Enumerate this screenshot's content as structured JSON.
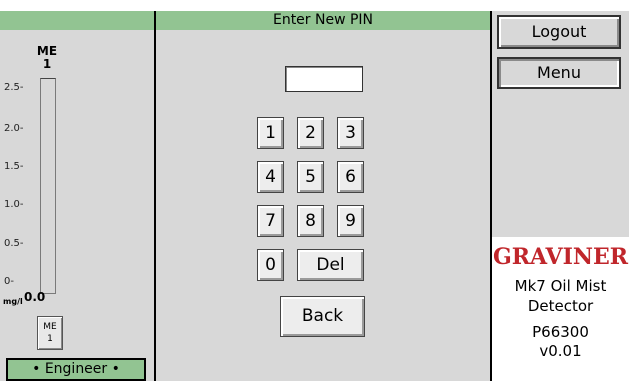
{
  "left_panel": {
    "sensor_label": "ME",
    "sensor_number": "1",
    "axis_ticks": [
      "2.5-",
      "2.0-",
      "1.5-",
      "1.0-",
      "0.5-",
      "0-"
    ],
    "unit": "mg/l",
    "reading": "0.0",
    "sensor_button_label": "ME",
    "sensor_button_number": "1",
    "user_level": "• Engineer •"
  },
  "center_panel": {
    "title": "Enter New PIN",
    "pin_value": "",
    "keys": [
      "1",
      "2",
      "3",
      "4",
      "5",
      "6",
      "7",
      "8",
      "9",
      "0"
    ],
    "delete_label": "Del",
    "back_label": "Back"
  },
  "right_panel": {
    "logout_label": "Logout",
    "menu_label": "Menu",
    "brand": "GRAVINER",
    "product_line1": "Mk7 Oil Mist",
    "product_line2": "Detector",
    "part_number": "P66300",
    "version": "v0.01"
  },
  "colors": {
    "header_green": "#92c492",
    "panel_grey": "#d8d8d8",
    "brand_red": "#c0262b"
  }
}
